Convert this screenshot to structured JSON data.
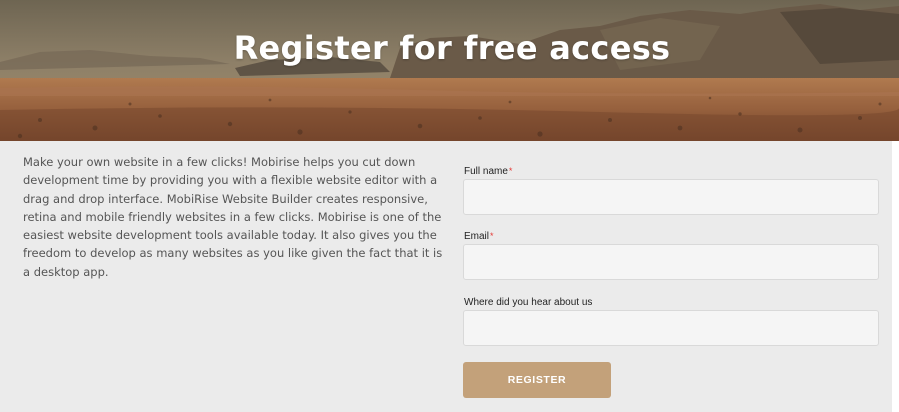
{
  "hero": {
    "title": "Register for free access"
  },
  "intro": {
    "text": "Make your own website in a few clicks! Mobirise helps you cut down development time by providing you with a flexible website editor with a drag and drop interface. MobiRise Website Builder creates responsive, retina and mobile friendly websites in a few clicks. Mobirise is one of the easiest website development tools available today. It also gives you the freedom to develop as many websites as you like given the fact that it is a desktop app."
  },
  "form": {
    "full_name_label": "Full name",
    "email_label": "Email",
    "source_label": "Where did you hear about us",
    "required_marker": "*",
    "full_name_value": "",
    "email_value": "",
    "source_value": "",
    "submit_label": "REGISTER"
  },
  "colors": {
    "section_background": "#ebebeb",
    "input_background": "#f5f5f5",
    "button_background": "#c3a17a",
    "required_marker": "#e53935"
  }
}
